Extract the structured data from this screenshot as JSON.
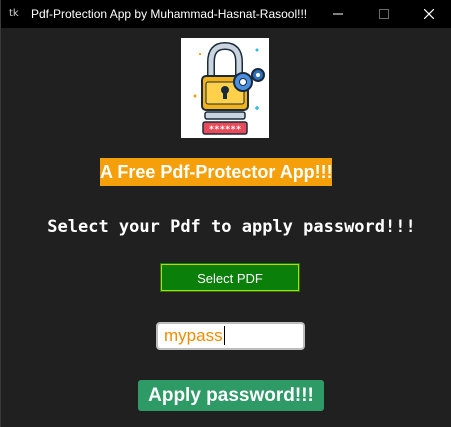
{
  "window": {
    "title": "Pdf-Protection App by Muhammad-Hasnat-Rasool!!!",
    "app_icon_glyph": "tk",
    "minimize_glyph": "—",
    "maximize_glyph": "☐",
    "close_glyph": "✕"
  },
  "logo": {
    "icon": "padlock-with-gears-logo",
    "mask_text": "******"
  },
  "main": {
    "tagline": "A Free Pdf-Protector App!!!",
    "instruction": "Select your Pdf to apply password!!!",
    "select_button_label": "Select PDF",
    "password_value": "mypass",
    "apply_button_label": "Apply password!!!"
  },
  "colors": {
    "titlebar": "#000000",
    "background": "#202020",
    "tagline_bg": "#f5a00a",
    "select_button_bg": "#0a7f0a",
    "apply_button_bg": "#2e9a66",
    "password_text": "#f08c00"
  }
}
